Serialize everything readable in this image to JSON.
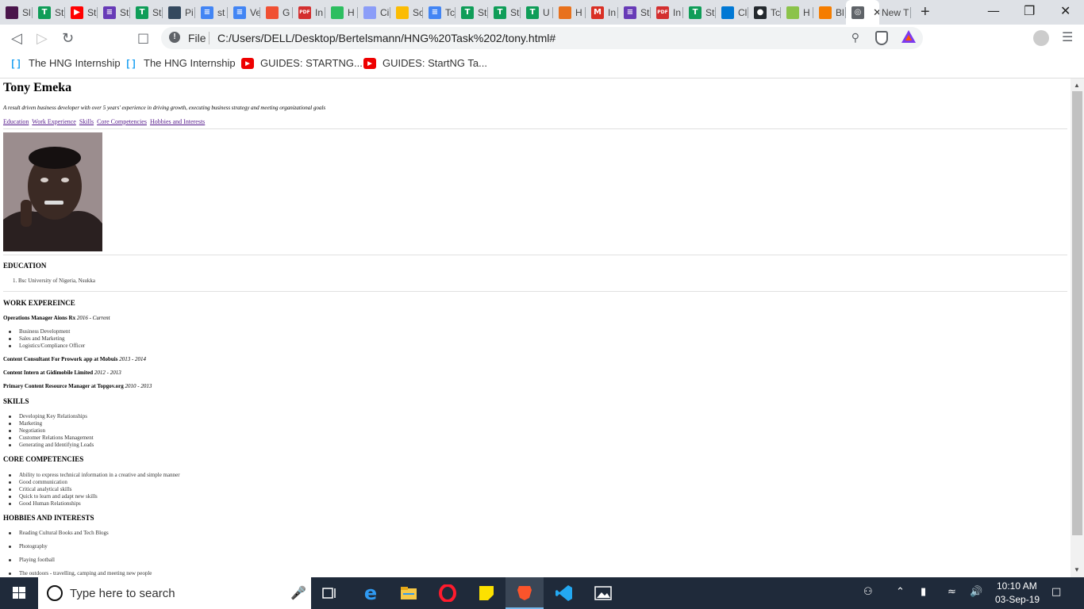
{
  "browser": {
    "tabs": [
      {
        "label": "Sl",
        "icon": "slack-icon",
        "color": "#4a154b"
      },
      {
        "label": "St",
        "icon": "trello-icon",
        "color": "#0f9d58"
      },
      {
        "label": "St",
        "icon": "youtube-icon",
        "color": "#ff0000"
      },
      {
        "label": "St",
        "icon": "forms-icon",
        "color": "#673ab7"
      },
      {
        "label": "St",
        "icon": "trello-icon",
        "color": "#0f9d58"
      },
      {
        "label": "Pi",
        "icon": "classroom-icon",
        "color": "#34495e"
      },
      {
        "label": "st",
        "icon": "docs-icon",
        "color": "#4285f4"
      },
      {
        "label": "Ve",
        "icon": "docs-icon",
        "color": "#4285f4"
      },
      {
        "label": "G",
        "icon": "git-icon",
        "color": "#f05033"
      },
      {
        "label": "In",
        "icon": "pdf-icon",
        "color": "#d32f2f"
      },
      {
        "label": "H",
        "icon": "evernote-icon",
        "color": "#2dbe60"
      },
      {
        "label": "Ci",
        "icon": "hexagon-icon",
        "color": "#8b9df8"
      },
      {
        "label": "Sc",
        "icon": "drive-icon",
        "color": "#fbbc04"
      },
      {
        "label": "Tc",
        "icon": "docs-icon",
        "color": "#4285f4"
      },
      {
        "label": "St",
        "icon": "trello-icon",
        "color": "#0f9d58"
      },
      {
        "label": "St",
        "icon": "trello-icon",
        "color": "#0f9d58"
      },
      {
        "label": "U",
        "icon": "trello-icon",
        "color": "#0f9d58"
      },
      {
        "label": "H",
        "icon": "orange-circle-icon",
        "color": "#e8711c"
      },
      {
        "label": "In",
        "icon": "gmail-icon",
        "color": "#d93025"
      },
      {
        "label": "St",
        "icon": "forms-icon",
        "color": "#673ab7"
      },
      {
        "label": "In",
        "icon": "pdf-icon",
        "color": "#d32f2f"
      },
      {
        "label": "St",
        "icon": "trello-icon",
        "color": "#0f9d58"
      },
      {
        "label": "Cl",
        "icon": "cloud-icon",
        "color": "#0078d4"
      },
      {
        "label": "Tc",
        "icon": "github-icon",
        "color": "#24292e"
      },
      {
        "label": "H",
        "icon": "w3-icon",
        "color": "#8bc34a"
      },
      {
        "label": "Bl",
        "icon": "blogger-icon",
        "color": "#f57d00"
      },
      {
        "label": "",
        "icon": "globe-icon",
        "color": "#5f6368",
        "active": true
      },
      {
        "label": "New T",
        "icon": "",
        "color": ""
      }
    ],
    "address": {
      "scheme_label": "File",
      "url": "C:/Users/DELL/Desktop/Bertelsmann/HNG%20Task%202/tony.html#"
    },
    "bookmarks": [
      {
        "label": "The HNG Internship",
        "icon": "brackets-icon"
      },
      {
        "label": "The HNG Internship",
        "icon": "brackets-icon"
      },
      {
        "label": "GUIDES: STARTNG...",
        "icon": "youtube-icon"
      },
      {
        "label": "GUIDES: StartNG Ta...",
        "icon": "youtube-icon"
      }
    ]
  },
  "page": {
    "name": "Tony Emeka",
    "tagline": "A result driven business developer with over 5 years' experience in driving growth, executing business strategy and meeting organizational goals",
    "nav_links": [
      "Education",
      "Work Experience",
      "Skills",
      "Core Competencies",
      "Hobbies and Interests"
    ],
    "education": {
      "heading": "EDUCATION",
      "items": [
        "1. Bsc University of Nigeria, Nsukka"
      ]
    },
    "work": {
      "heading": "WORK EXPEREINCE",
      "jobs": [
        {
          "title": "Operations Manager Aions Rx",
          "period": "2016 - Current",
          "duties": [
            "Business Development",
            "Sales and Marketing",
            "Logistics/Compliance Officer"
          ]
        },
        {
          "title": "Content Consultant For Prowork app at Mobuis",
          "period": "2013 - 2014"
        },
        {
          "title": "Content Intern at Gidimobile Limited",
          "period": "2012 - 2013"
        },
        {
          "title": "Primary Content Resource Manager at Topgov.org",
          "period": "2010 - 2013"
        }
      ]
    },
    "skills": {
      "heading": "SKILLS",
      "items": [
        "Developing Key Relationships",
        "Marketing",
        "Negotiation",
        "Customer Relations Management",
        "Generating and Identifying Leads"
      ]
    },
    "core": {
      "heading": "CORE COMPETENCIES",
      "items": [
        "Ability to express technical information in a creative and simple manner",
        "Good communication",
        "Critical analytical skills",
        "Quick to learn and adapt new skills",
        "Good Human Relationships"
      ]
    },
    "hobbies": {
      "heading": "HOBBIES AND INTERESTS",
      "items": [
        "Reading Cultural Books and Tech Blogs",
        "Photography",
        "Playing football",
        "The outdoors - travelling, camping and meeting new people"
      ]
    }
  },
  "taskbar": {
    "search_placeholder": "Type here to search",
    "apps": [
      "task-view-icon",
      "edge-icon",
      "file-explorer-icon",
      "opera-icon",
      "sticky-notes-icon",
      "brave-icon",
      "vscode-icon",
      "photos-icon"
    ],
    "time": "10:10 AM",
    "date": "03-Sep-19"
  }
}
